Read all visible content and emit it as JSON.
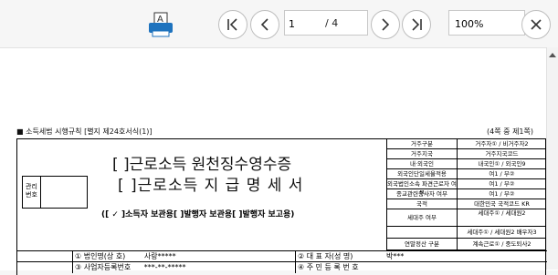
{
  "toolbar": {
    "print_label": "A",
    "page_current": "1",
    "page_total": "/ 4",
    "zoom_value": "100%"
  },
  "document": {
    "law_reference": "■ 소득세법 시행규칙 [별지 제24호서식(1)]",
    "page_info": "(4쪽 중 제1쪽)",
    "mgmt_label": "관리\n번호",
    "title_line1": "[ ]근로소득 원천징수영수증",
    "title_line2": "[ ]근로소득 지 급 명 세 서",
    "options": "([ ✓ ]소득자 보관용[    ]발행자 보관용[    ]발행자 보고용)",
    "side_rows": [
      {
        "c1": "거주구분",
        "c2": "거주자① / 비거주자2"
      },
      {
        "c1": "거주지국",
        "c2": "거주지국코드"
      },
      {
        "c1": "내·외국인",
        "c2": "내국인① / 외국인9"
      },
      {
        "c1": "외국인단일세율적용",
        "c2": "여1 / 부②"
      },
      {
        "c1": "외국법인소속 파견근로자 여부",
        "c2": "여1 / 부②"
      },
      {
        "c1": "종교관련종사자 여부",
        "c2": "여1 / 부②"
      },
      {
        "c1": "국적",
        "c2": "대한민국   국적코드   KR"
      },
      {
        "c1": "세대주 여부",
        "c2": "세대주① / 세대원2"
      },
      {
        "c1": "",
        "c2": "세대주① / 세대원2 배우자3"
      },
      {
        "c1": "연말정산 구분",
        "c2": "계속근로① / 중도퇴사2"
      }
    ],
    "row_company_label": "① 법인명(상 호)",
    "row_company_value": "사랑*****",
    "row_rep_label": "② 대 표 자(성 명)",
    "row_rep_value": "박***",
    "row_reg_label": "③ 사업자등록번호",
    "row_reg_value": "***-**-*****",
    "row_corp_label": "④ 주 민 등 록 번 호"
  }
}
